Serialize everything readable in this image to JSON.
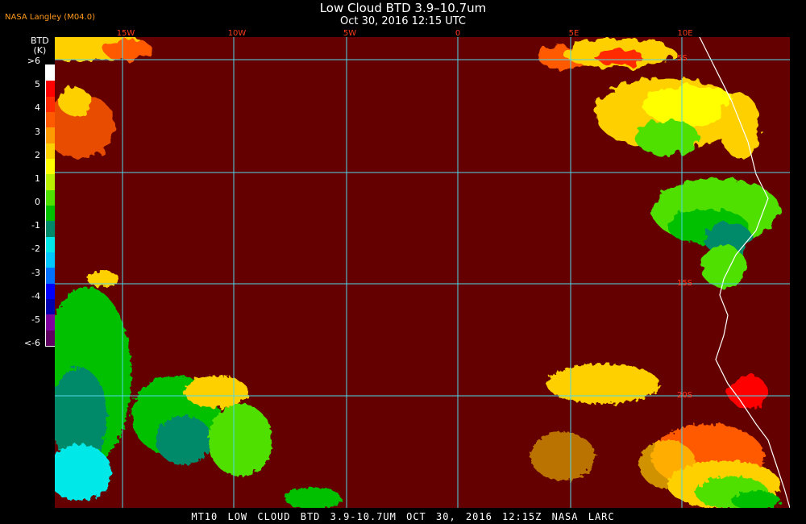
{
  "header": {
    "title": "Low Cloud BTD 3.9–10.7um",
    "subtitle": "Oct 30, 2016 12:15 UTC",
    "producer": "NASA Langley (M04.0)"
  },
  "legend": {
    "title_line1": "BTD",
    "title_line2": "(K)",
    "ticks": [
      ">6",
      "5",
      "4",
      "3",
      "2",
      "1",
      "0",
      "-1",
      "-2",
      "-3",
      "-4",
      "-5",
      "<-6"
    ],
    "colors": [
      "#ffffff",
      "#ff0000",
      "#ff2a00",
      "#ff5a00",
      "#ff9a00",
      "#ffd000",
      "#ffff00",
      "#b8f000",
      "#50e000",
      "#00c000",
      "#008a6a",
      "#00e8e8",
      "#00c8ff",
      "#0070ff",
      "#0000ff",
      "#0000b0",
      "#8000a0",
      "#600060"
    ]
  },
  "map": {
    "longitude_labels": [
      "15W",
      "10W",
      "5W",
      "0",
      "5E",
      "10E"
    ],
    "latitude_labels": [
      "5S",
      "15S",
      "20S"
    ],
    "grid_color": "#4fd8e8",
    "background_color": "#650000"
  },
  "footer": {
    "caption": "MT10  LOW CLOUD BTD 3.9-10.7UM  OCT 30, 2016 12:15Z  NASA LARC"
  }
}
